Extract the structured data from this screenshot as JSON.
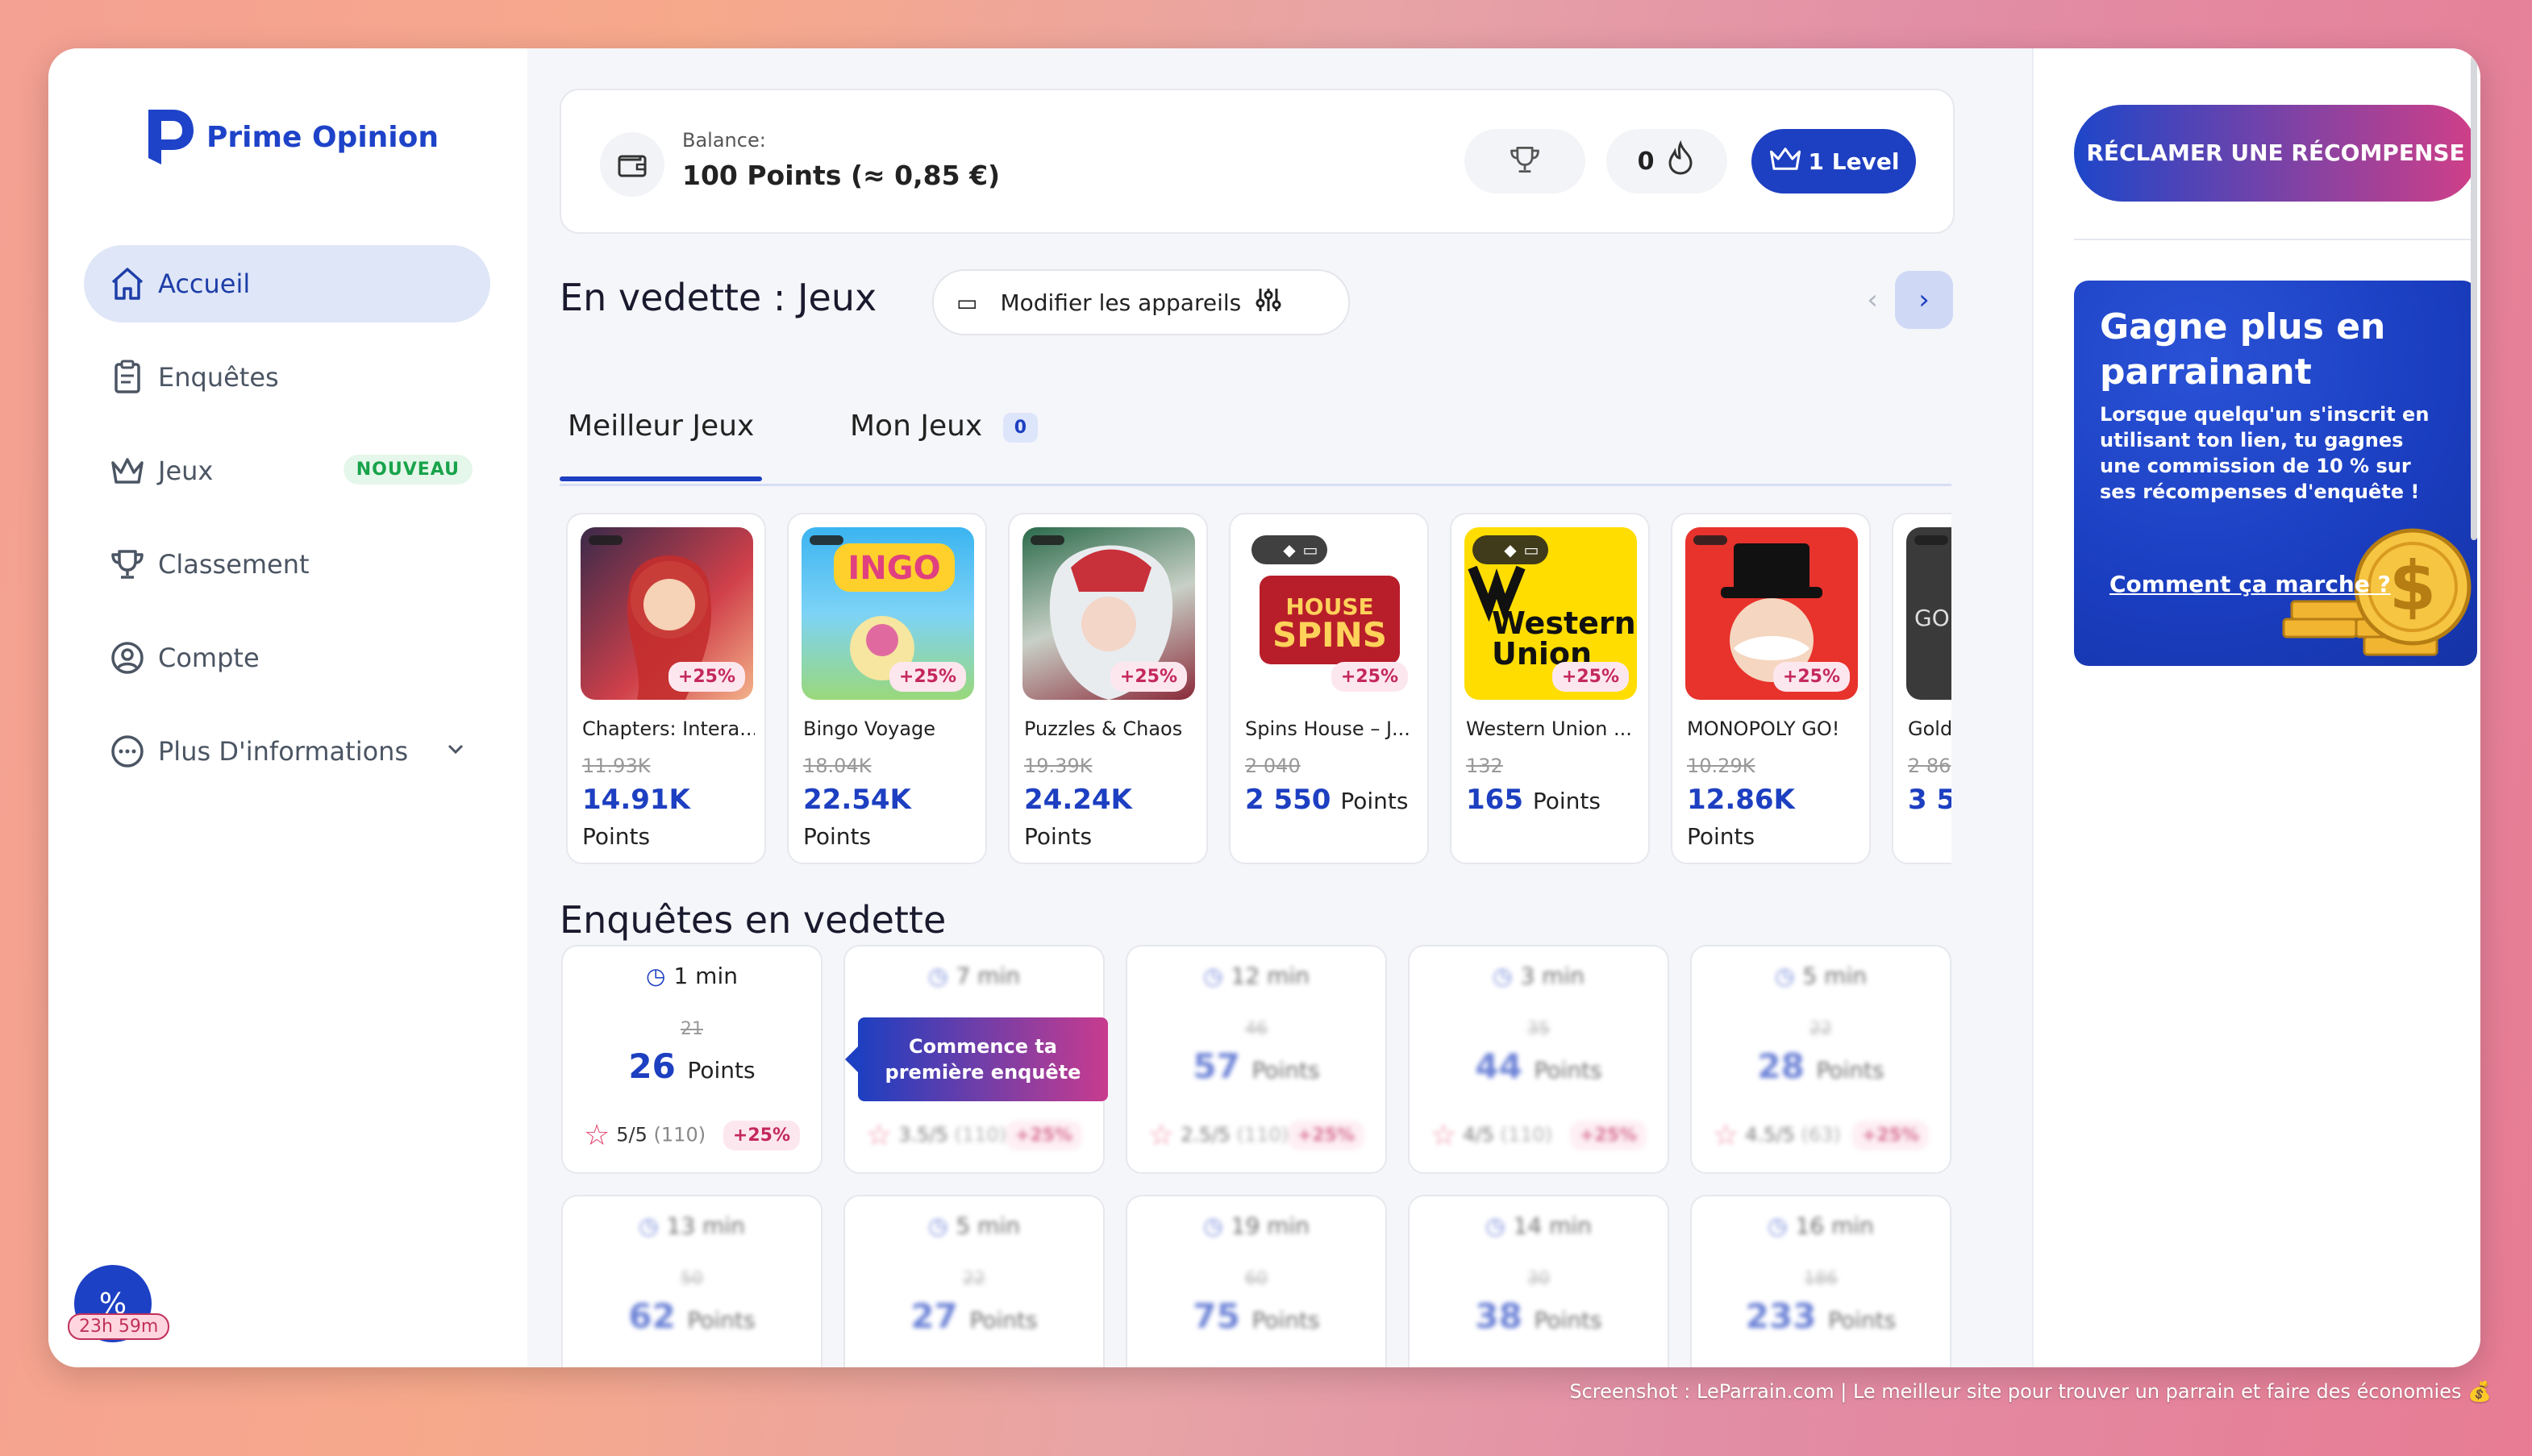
{
  "brand": {
    "name": "Prime Opinion"
  },
  "sidebar": {
    "items": [
      {
        "label": "Accueil",
        "icon": "home-icon",
        "active": true
      },
      {
        "label": "Enquêtes",
        "icon": "clipboard-icon"
      },
      {
        "label": "Jeux",
        "icon": "crown-icon",
        "badge": "NOUVEAU"
      },
      {
        "label": "Classement",
        "icon": "trophy-icon"
      },
      {
        "label": "Compte",
        "icon": "user-circle-icon"
      },
      {
        "label": "Plus D'informations",
        "icon": "more-dots-icon"
      }
    ],
    "promo": {
      "symbol": "%",
      "timer": "23h 59m"
    }
  },
  "header": {
    "balance_label": "Balance:",
    "balance_value": "100 Points (≈ 0,85 €)",
    "streak": "0",
    "level": "1 Level"
  },
  "featured": {
    "title": "En vedette : Jeux",
    "devices_button": "Modifier les appareils",
    "tabs": [
      {
        "label": "Meilleur Jeux"
      },
      {
        "label": "Mon Jeux",
        "count": "0"
      }
    ],
    "games": [
      {
        "name": "Chapters: Intera...",
        "old": "11.93K",
        "new": "14.91K",
        "unit": "Points",
        "boost": "+25%"
      },
      {
        "name": "Bingo Voyage",
        "old": "18.04K",
        "new": "22.54K",
        "unit": "Points",
        "boost": "+25%"
      },
      {
        "name": "Puzzles & Chaos",
        "old": "19.39K",
        "new": "24.24K",
        "unit": "Points",
        "boost": "+25%"
      },
      {
        "name": "Spins House – J...",
        "old": "2 040",
        "new": "2 550",
        "unit": "Points",
        "boost": "+25%"
      },
      {
        "name": "Western Union ...",
        "old": "132",
        "new": "165",
        "unit": "Points",
        "boost": "+25%",
        "img_text": "Western Union"
      },
      {
        "name": "MONOPOLY GO!",
        "old": "10.29K",
        "new": "12.86K",
        "unit": "Points",
        "boost": "+25%"
      },
      {
        "name": "Gold",
        "old": "2 86",
        "new": "3 5",
        "unit": "",
        "boost": "",
        "img_text": "GO"
      }
    ]
  },
  "surveys": {
    "title": "Enquêtes en vedette",
    "tooltip": "Commence ta première enquête",
    "items": [
      {
        "time": "1 min",
        "old": "21",
        "new": "26",
        "unit": "Points",
        "rating": "5/5",
        "count": "(110)",
        "boost": "+25%"
      },
      {
        "time": "7 min",
        "old": "",
        "new": "",
        "unit": "",
        "rating": "3.5/5",
        "count": "(110)",
        "boost": "+25%"
      },
      {
        "time": "12 min",
        "old": "46",
        "new": "57",
        "unit": "Points",
        "rating": "2.5/5",
        "count": "(110)",
        "boost": "+25%"
      },
      {
        "time": "3 min",
        "old": "35",
        "new": "44",
        "unit": "Points",
        "rating": "4/5",
        "count": "(110)",
        "boost": "+25%"
      },
      {
        "time": "5 min",
        "old": "22",
        "new": "28",
        "unit": "Points",
        "rating": "4.5/5",
        "count": "(63)",
        "boost": "+25%"
      },
      {
        "time": "13 min",
        "old": "50",
        "new": "62",
        "unit": "Points"
      },
      {
        "time": "5 min",
        "old": "22",
        "new": "27",
        "unit": "Points"
      },
      {
        "time": "19 min",
        "old": "60",
        "new": "75",
        "unit": "Points"
      },
      {
        "time": "14 min",
        "old": "30",
        "new": "38",
        "unit": "Points"
      },
      {
        "time": "16 min",
        "old": "186",
        "new": "233",
        "unit": "Points"
      }
    ]
  },
  "right_panel": {
    "claim_button": "RÉCLAMER UNE RÉCOMPENSE",
    "referral": {
      "title": "Gagne plus en parrainant",
      "description": "Lorsque quelqu'un s'inscrit en utilisant ton lien, tu gagnes une commission de 10 % sur ses récompenses d'enquête !",
      "link": "Comment ça marche ?"
    }
  },
  "footer": {
    "text": "Screenshot : LeParrain.com | Le meilleur site pour trouver un parrain et faire des économies 💰"
  },
  "colors": {
    "accent": "#1d3fc1",
    "pink": "#d13f87",
    "boost_bg": "#fde7ef"
  }
}
